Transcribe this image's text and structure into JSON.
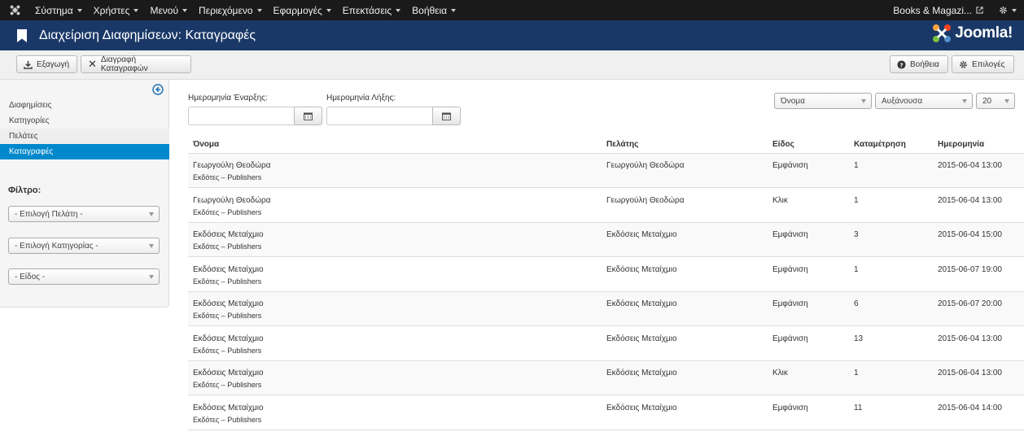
{
  "navbar": {
    "menu": [
      {
        "label": "Σύστημα"
      },
      {
        "label": "Χρήστες"
      },
      {
        "label": "Μενού"
      },
      {
        "label": "Περιεχόμενο"
      },
      {
        "label": "Εφαρμογές"
      },
      {
        "label": "Επεκτάσεις"
      },
      {
        "label": "Βοήθεια"
      }
    ],
    "site_label": "Books & Magazi..."
  },
  "header": {
    "title": "Διαχείριση Διαφημίσεων: Καταγραφές",
    "brand": "Joomla!"
  },
  "toolbar": {
    "export_label": "Εξαγωγή",
    "delete_logs_label": "Διαγραφή Καταγραφών",
    "help_label": "Βοήθεια",
    "options_label": "Επιλογές"
  },
  "sidebar": {
    "items": [
      {
        "label": "Διαφημίσεις"
      },
      {
        "label": "Κατηγορίες"
      },
      {
        "label": "Πελάτες"
      },
      {
        "label": "Καταγραφές"
      }
    ],
    "filter_title": "Φίλτρο:",
    "filters": [
      {
        "value": "- Επιλογή Πελάτη -"
      },
      {
        "value": "- Επιλογή Κατηγορίας -"
      },
      {
        "value": "- Είδος -"
      }
    ]
  },
  "dates": {
    "start_label": "Ημερομηνία Έναρξης:",
    "end_label": "Ημερομηνία Λήξης:",
    "start_value": "",
    "end_value": ""
  },
  "sorting": {
    "field": "Όνομα",
    "direction": "Αυξάνουσα",
    "limit": "20"
  },
  "table": {
    "columns": [
      "Όνομα",
      "Πελάτης",
      "Είδος",
      "Καταμέτρηση",
      "Ημερομηνία"
    ],
    "rows": [
      {
        "name": "Γεωργούλη Θεοδώρα",
        "category": "Εκδότες – Publishers",
        "client": "Γεωργούλη Θεοδώρα",
        "type": "Εμφάνιση",
        "count": "1",
        "date": "2015-06-04 13:00"
      },
      {
        "name": "Γεωργούλη Θεοδώρα",
        "category": "Εκδότες – Publishers",
        "client": "Γεωργούλη Θεοδώρα",
        "type": "Κλικ",
        "count": "1",
        "date": "2015-06-04 13:00"
      },
      {
        "name": "Εκδόσεις Μεταίχμιο",
        "category": "Εκδότες – Publishers",
        "client": "Εκδόσεις Μεταίχμιο",
        "type": "Εμφάνιση",
        "count": "3",
        "date": "2015-06-04 15:00"
      },
      {
        "name": "Εκδόσεις Μεταίχμιο",
        "category": "Εκδότες – Publishers",
        "client": "Εκδόσεις Μεταίχμιο",
        "type": "Εμφάνιση",
        "count": "1",
        "date": "2015-06-07 19:00"
      },
      {
        "name": "Εκδόσεις Μεταίχμιο",
        "category": "Εκδότες – Publishers",
        "client": "Εκδόσεις Μεταίχμιο",
        "type": "Εμφάνιση",
        "count": "6",
        "date": "2015-06-07 20:00"
      },
      {
        "name": "Εκδόσεις Μεταίχμιο",
        "category": "Εκδότες – Publishers",
        "client": "Εκδόσεις Μεταίχμιο",
        "type": "Εμφάνιση",
        "count": "13",
        "date": "2015-06-04 13:00"
      },
      {
        "name": "Εκδόσεις Μεταίχμιο",
        "category": "Εκδότες – Publishers",
        "client": "Εκδόσεις Μεταίχμιο",
        "type": "Κλικ",
        "count": "1",
        "date": "2015-06-04 13:00"
      },
      {
        "name": "Εκδόσεις Μεταίχμιο",
        "category": "Εκδότες – Publishers",
        "client": "Εκδόσεις Μεταίχμιο",
        "type": "Εμφάνιση",
        "count": "11",
        "date": "2015-06-04 14:00"
      }
    ]
  }
}
